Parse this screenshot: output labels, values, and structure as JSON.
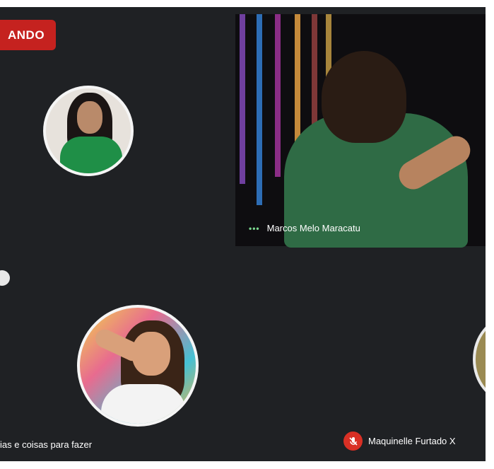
{
  "recording_badge": {
    "text": "ANDO"
  },
  "main_tile": {
    "participant_name": "Marcos Melo Maracatu",
    "speaking_indicator": "•••"
  },
  "bottom_bar": {
    "left_name": "ias e coisas para fazer",
    "right_name": "Maquinelle Furtado X"
  },
  "colors": {
    "background": "#1f2124",
    "recording_red": "#c5221f",
    "mute_red": "#d93025"
  },
  "icons": {
    "speaking": "speaking-dots-icon",
    "mute": "mic-off-icon"
  }
}
